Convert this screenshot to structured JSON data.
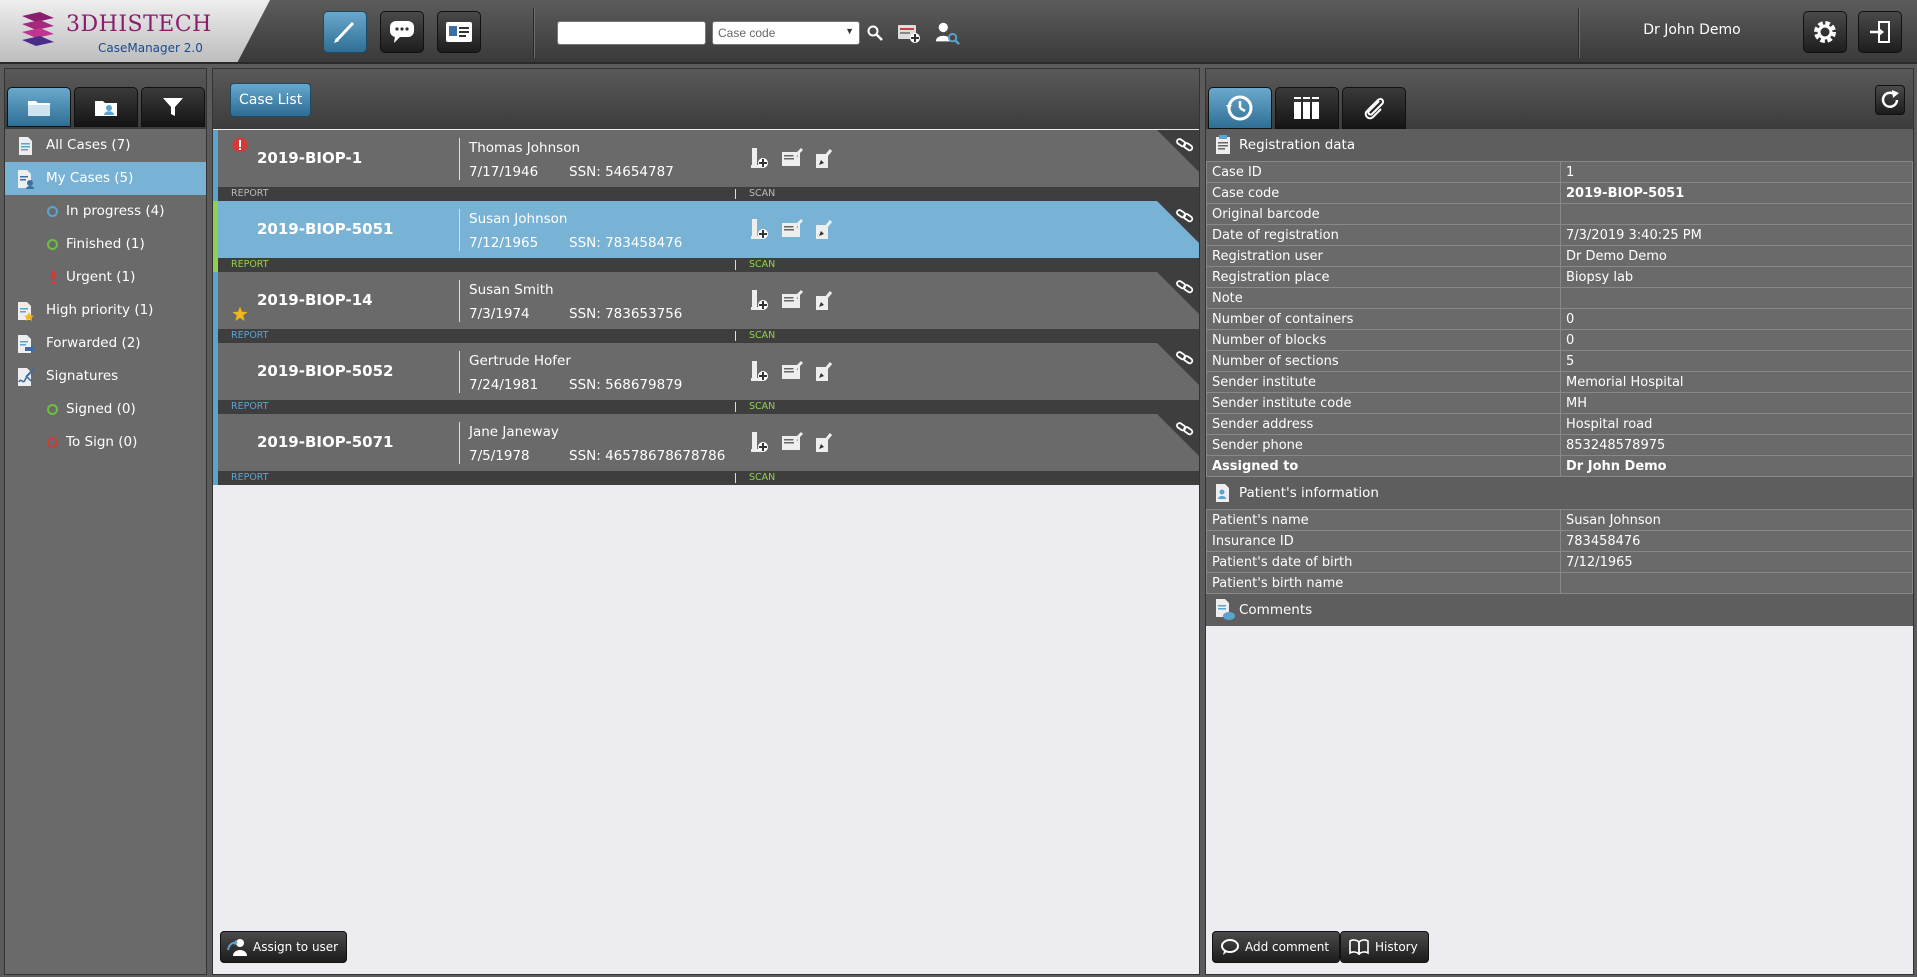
{
  "app": {
    "logo_text": "3DHISTECH",
    "subtitle": "CaseManager 2.0",
    "user": "Dr John Demo"
  },
  "toolbar": {
    "search_value": "",
    "search_type": "Case code",
    "buttons": [
      "pen-icon",
      "chat-icon",
      "id-card-icon"
    ]
  },
  "sidebar": {
    "tabs": [
      "folder-icon",
      "shared-folder-icon",
      "filter-icon"
    ],
    "items": [
      {
        "label": "All Cases (7)",
        "icon": "document-icon"
      },
      {
        "label": "My Cases (5)",
        "icon": "user-document-icon"
      },
      {
        "label": "In progress (4)",
        "dot": "#5ba4d0"
      },
      {
        "label": "Finished (1)",
        "dot": "#6cc040"
      },
      {
        "label": "Urgent (1)",
        "icon": "exclamation-icon"
      },
      {
        "label": "High priority (1)",
        "icon": "star-document-icon"
      },
      {
        "label": "Forwarded (2)",
        "icon": "forward-document-icon"
      },
      {
        "label": "Signatures",
        "icon": "signature-icon"
      },
      {
        "label": "Signed (0)",
        "dot": "#6cc040"
      },
      {
        "label": "To Sign (0)",
        "dot": "#d23a3a"
      }
    ]
  },
  "center": {
    "case_list_label": "Case List",
    "assign_label": "Assign to user",
    "cases": [
      {
        "id": "2019-BIOP-1",
        "name": "Thomas Johnson",
        "dob": "7/17/1946",
        "ssn": "SSN: 54654787",
        "report": "REPORT",
        "scan": "SCAN",
        "flag": "urgent"
      },
      {
        "id": "2019-BIOP-5051",
        "name": "Susan Johnson",
        "dob": "7/12/1965",
        "ssn": "SSN: 783458476",
        "report": "REPORT",
        "scan": "SCAN",
        "flag": ""
      },
      {
        "id": "2019-BIOP-14",
        "name": "Susan Smith",
        "dob": "7/3/1974",
        "ssn": "SSN: 783653756",
        "report": "REPORT",
        "scan": "SCAN",
        "flag": "star"
      },
      {
        "id": "2019-BIOP-5052",
        "name": "Gertrude Hofer",
        "dob": "7/24/1981",
        "ssn": "SSN: 568679879",
        "report": "REPORT",
        "scan": "SCAN",
        "flag": ""
      },
      {
        "id": "2019-BIOP-5071",
        "name": "Jane Janeway",
        "dob": "7/5/1978",
        "ssn": "SSN: 46578678678786",
        "report": "REPORT",
        "scan": "SCAN",
        "flag": ""
      }
    ]
  },
  "details": {
    "tabs": [
      "history-icon",
      "slides-icon",
      "attachment-icon"
    ],
    "registration_title": "Registration data",
    "registration": [
      {
        "k": "Case ID",
        "v": "1"
      },
      {
        "k": "Case code",
        "v": "2019-BIOP-5051",
        "bold_v": true
      },
      {
        "k": "Original barcode",
        "v": ""
      },
      {
        "k": "Date of registration",
        "v": "7/3/2019 3:40:25 PM"
      },
      {
        "k": "Registration user",
        "v": "Dr Demo Demo"
      },
      {
        "k": "Registration place",
        "v": "Biopsy lab"
      },
      {
        "k": "Note",
        "v": ""
      },
      {
        "k": "Number of containers",
        "v": "0"
      },
      {
        "k": "Number of blocks",
        "v": "0"
      },
      {
        "k": "Number of sections",
        "v": "5"
      },
      {
        "k": "Sender institute",
        "v": "Memorial Hospital"
      },
      {
        "k": "Sender institute code",
        "v": "MH"
      },
      {
        "k": "Sender address",
        "v": "Hospital road"
      },
      {
        "k": "Sender phone",
        "v": "853248578975"
      },
      {
        "k": "Assigned to",
        "v": "Dr John Demo",
        "bold_k": true,
        "bold_v": true
      }
    ],
    "patient_title": "Patient's information",
    "patient": [
      {
        "k": "Patient's name",
        "v": "Susan Johnson"
      },
      {
        "k": "Insurance ID",
        "v": "783458476"
      },
      {
        "k": "Patient's date of birth",
        "v": "7/12/1965"
      },
      {
        "k": "Patient's birth name",
        "v": ""
      }
    ],
    "comments_title": "Comments",
    "add_comment_label": "Add comment",
    "history_label": "History"
  },
  "colors": {
    "accent": "#78b3d6",
    "report": "#5ba4d0",
    "scan": "#8fd14f",
    "urgent": "#d23a3a",
    "star": "#f2b51c"
  }
}
